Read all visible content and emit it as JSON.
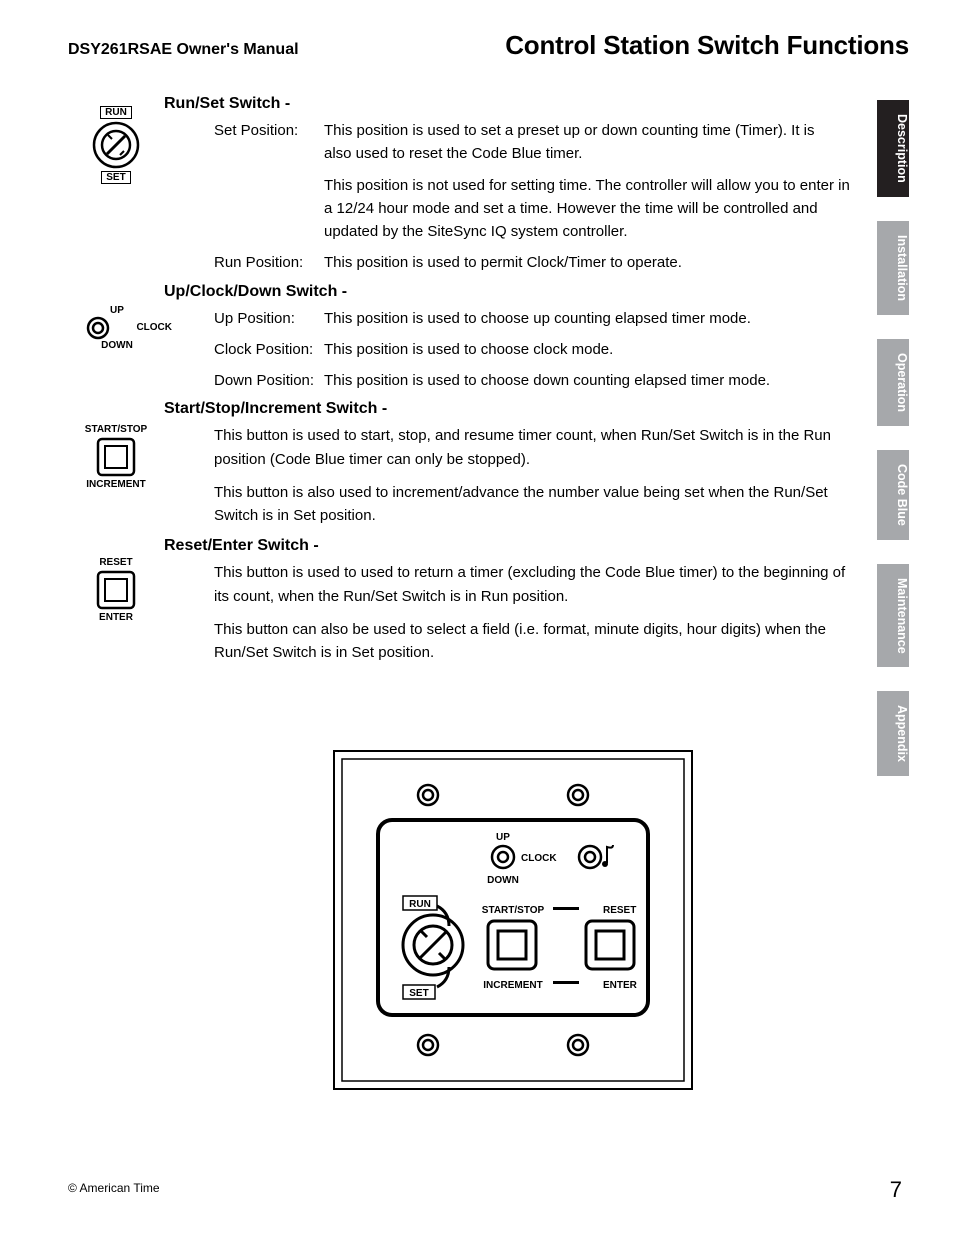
{
  "header": {
    "manual_title": "DSY261RSAE Owner's Manual",
    "page_title": "Control Station Switch Functions"
  },
  "tabs": [
    {
      "label": "Description",
      "style": "dark"
    },
    {
      "label": "Installation",
      "style": "light"
    },
    {
      "label": "Operation",
      "style": "light"
    },
    {
      "label": "Code Blue",
      "style": "light"
    },
    {
      "label": "Maintenance",
      "style": "light"
    },
    {
      "label": "Appendix",
      "style": "light"
    }
  ],
  "sections": {
    "runset": {
      "heading": "Run/Set Switch",
      "rows": [
        {
          "term": "Set Position:",
          "desc": "This position is used to set a preset up or down counting time (Timer). It is also used to reset the Code Blue timer."
        },
        {
          "term": "",
          "desc": "This position is not used for setting time. The controller will allow you to enter in a 12/24 hour mode and set a time. However the time will be controlled and updated by the SiteSync IQ system controller."
        },
        {
          "term": "Run Position:",
          "desc": "This position is used to permit Clock/Timer to operate."
        }
      ],
      "illus": {
        "top_label": "RUN",
        "bottom_label": "SET"
      }
    },
    "updown": {
      "heading": "Up/Clock/Down Switch",
      "rows": [
        {
          "term": "Up Position:",
          "desc": "This position is used to choose up counting elapsed timer mode."
        },
        {
          "term": "Clock Position:",
          "desc": "This position is used to choose clock mode."
        },
        {
          "term": "Down Position:",
          "desc": "This position is used to choose down counting elapsed timer mode."
        }
      ],
      "illus": {
        "top_label": "UP",
        "side_label": "CLOCK",
        "bottom_label": "DOWN"
      }
    },
    "startstop": {
      "heading": "Start/Stop/Increment Switch",
      "paras": [
        "This button is used to start, stop, and resume timer count, when Run/Set Switch is in the Run position (Code Blue timer can only be stopped).",
        "This button is also used to increment/advance the number value being set when the Run/Set Switch is in Set position."
      ],
      "illus": {
        "top_label": "START/STOP",
        "bottom_label": "INCREMENT"
      }
    },
    "reset": {
      "heading": "Reset/Enter Switch",
      "paras": [
        "This button is used to used to return a timer (excluding the Code Blue timer) to the beginning of its count, when the Run/Set Switch is in Run position.",
        "This button can also be used to select a field (i.e. format, minute digits, hour digits) when the Run/Set Switch is in Set position."
      ],
      "illus": {
        "top_label": "RESET",
        "bottom_label": "ENTER"
      }
    }
  },
  "panel": {
    "labels": {
      "up": "UP",
      "clock": "CLOCK",
      "down": "DOWN",
      "run": "RUN",
      "set": "SET",
      "startstop": "START/STOP",
      "reset": "RESET",
      "increment": "INCREMENT",
      "enter": "ENTER"
    }
  },
  "footer": {
    "copyright": "© American Time",
    "page_number": "7"
  }
}
